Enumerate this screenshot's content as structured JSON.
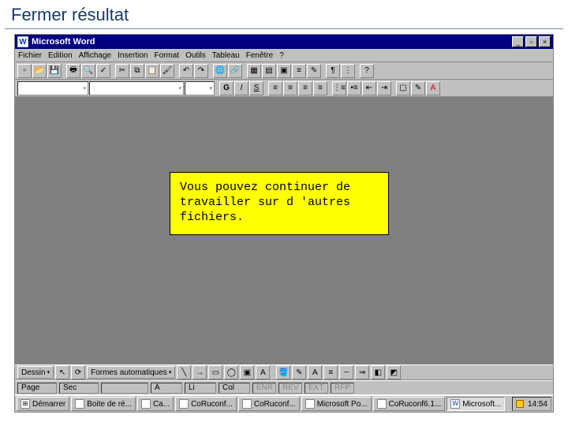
{
  "slide": {
    "title": "Fermer résultat"
  },
  "titlebar": {
    "icon_letter": "W",
    "app_name": "Microsoft Word",
    "min_label": "_",
    "max_label": "▫",
    "close_label": "×"
  },
  "menu": {
    "file": "Fichier",
    "edit": "Edition",
    "view": "Affichage",
    "insert": "Insertion",
    "format": "Format",
    "tools": "Outils",
    "table": "Tableau",
    "window": "Fenêtre",
    "help": "?"
  },
  "callout": {
    "text": "Vous pouvez continuer de travailler sur d 'autres fichiers."
  },
  "status": {
    "page": "Page",
    "sec": "Sec",
    "at": "À",
    "ln": "Li",
    "col": "Col"
  },
  "drawbar": {
    "draw_label": "Dessin",
    "autoshapes": "Formes automatiques"
  },
  "taskbar": {
    "start": "Démarrer",
    "items": [
      {
        "label": "Boite de ré..."
      },
      {
        "label": "Ca..."
      },
      {
        "label": "CoRuconf..."
      },
      {
        "label": "CoRuconf..."
      },
      {
        "label": "Microsoft Po..."
      },
      {
        "label": "CoRuconf6.1..."
      },
      {
        "label": "Microsoft..."
      }
    ],
    "clock": "14:54"
  }
}
